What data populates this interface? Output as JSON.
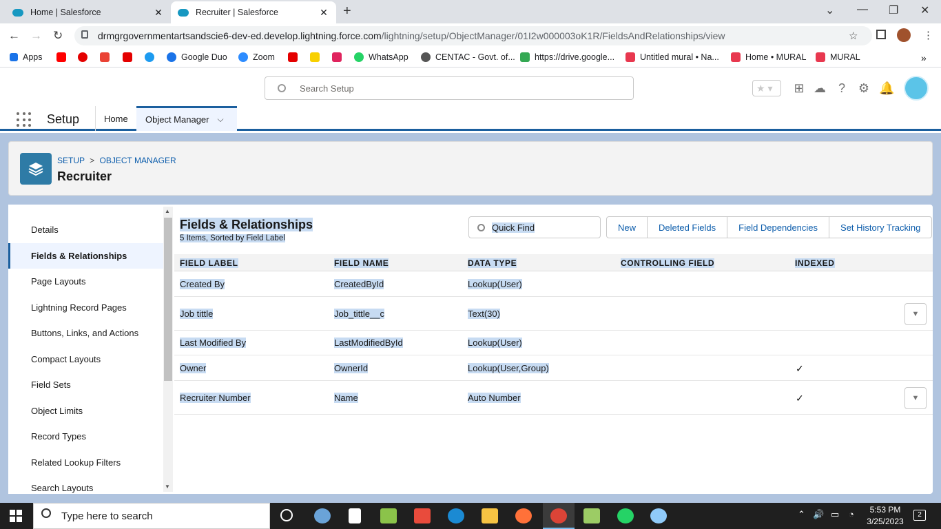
{
  "browser": {
    "tabs": [
      {
        "title": "Home | Salesforce",
        "active": false
      },
      {
        "title": "Recruiter | Salesforce",
        "active": true
      }
    ],
    "url_domain": "drmgrgovernmentartsandscie6-dev-ed.develop.lightning.force.com",
    "url_path": "/lightning/setup/ObjectManager/01I2w000003oK1R/FieldsAndRelationships/view",
    "bookmarks": [
      "Apps",
      "Google Duo",
      "Zoom",
      "WhatsApp",
      "CENTAC - Govt. of...",
      "https://drive.google...",
      "Untitled mural • Na...",
      "Home • MURAL",
      "MURAL"
    ]
  },
  "header": {
    "search_placeholder": "Search Setup"
  },
  "nav": {
    "app": "Setup",
    "home": "Home",
    "object_manager": "Object Manager"
  },
  "page_header": {
    "breadcrumb_setup": "SETUP",
    "breadcrumb_sep": ">",
    "breadcrumb_om": "OBJECT MANAGER",
    "title": "Recruiter"
  },
  "sidebar": {
    "items": [
      {
        "label": "Details",
        "selected": false
      },
      {
        "label": "Fields & Relationships",
        "selected": true
      },
      {
        "label": "Page Layouts",
        "selected": false
      },
      {
        "label": "Lightning Record Pages",
        "selected": false
      },
      {
        "label": "Buttons, Links, and Actions",
        "selected": false
      },
      {
        "label": "Compact Layouts",
        "selected": false
      },
      {
        "label": "Field Sets",
        "selected": false
      },
      {
        "label": "Object Limits",
        "selected": false
      },
      {
        "label": "Record Types",
        "selected": false
      },
      {
        "label": "Related Lookup Filters",
        "selected": false
      },
      {
        "label": "Search Layouts",
        "selected": false
      }
    ]
  },
  "fields": {
    "title": "Fields & Relationships",
    "subtitle": "5 Items, Sorted by Field Label",
    "quick_find": "Quick Find",
    "buttons": {
      "new": "New",
      "deleted": "Deleted Fields",
      "dependencies": "Field Dependencies",
      "history": "Set History Tracking"
    },
    "columns": [
      "FIELD LABEL",
      "FIELD NAME",
      "DATA TYPE",
      "CONTROLLING FIELD",
      "INDEXED"
    ],
    "rows": [
      {
        "label": "Created By",
        "name": "CreatedById",
        "type": "Lookup(User)",
        "indexed": false,
        "menu": false
      },
      {
        "label": "Job tittle",
        "name": "Job_tittle__c",
        "type": "Text(30)",
        "indexed": false,
        "menu": true
      },
      {
        "label": "Last Modified By",
        "name": "LastModifiedById",
        "type": "Lookup(User)",
        "indexed": false,
        "menu": false
      },
      {
        "label": "Owner",
        "name": "OwnerId",
        "type": "Lookup(User,Group)",
        "indexed": true,
        "menu": false
      },
      {
        "label": "Recruiter Number",
        "name": "Name",
        "type": "Auto Number",
        "indexed": true,
        "menu": true
      }
    ]
  },
  "taskbar": {
    "search": "Type here to search",
    "time": "5:53 PM",
    "date": "3/25/2023",
    "notifications": "2"
  }
}
